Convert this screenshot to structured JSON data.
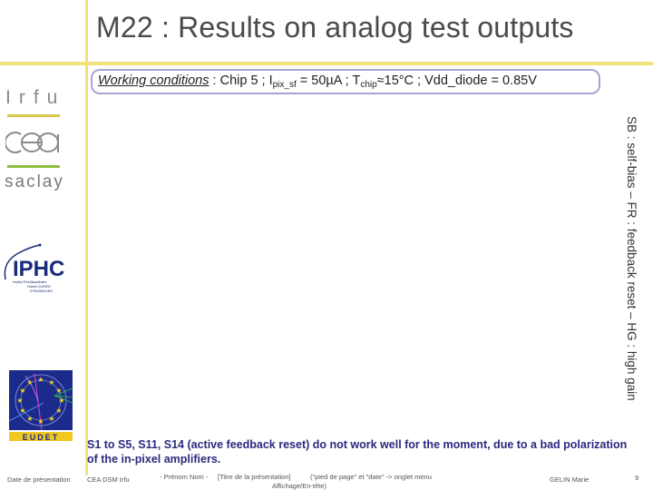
{
  "slide": {
    "title": "M22 : Results on analog test outputs",
    "working_conditions": {
      "label": "Working conditions",
      "sep": " :  ",
      "chip": "Chip 5 ; I",
      "ipix_sub": "pix_sf",
      "ipix_val": " = 50µA ; T",
      "tchip_sub": "chip",
      "rest": "≈15°C ; Vdd_diode = 0.85V"
    },
    "side_note": "SB : self-bias – FR : feedback reset – HG : high gain",
    "note": "S1 to S5, S11, S14 (active feedback reset) do not work well for the moment, due to a bad polarization of the in-pixel amplifiers."
  },
  "logos": {
    "irfu": "Irfu",
    "saclay": "saclay",
    "iphc": "IPHC",
    "iphc_sub": "Institut Pluridisciplinaire Hubert CURIEN STRASBOURG",
    "eudet": "EUDET"
  },
  "footer": {
    "date": "Date de présentation",
    "org": "CEA DSM Irfu",
    "author_placeholder": "- Prénom Nom -",
    "title_placeholder": "[Titre de la présentation]",
    "hint_line1": "(\"pied de page\" et \"date\" -> onglet menu",
    "hint_line2": "Affichage/En-tête)",
    "author": "GELIN Marie",
    "page": "9"
  }
}
